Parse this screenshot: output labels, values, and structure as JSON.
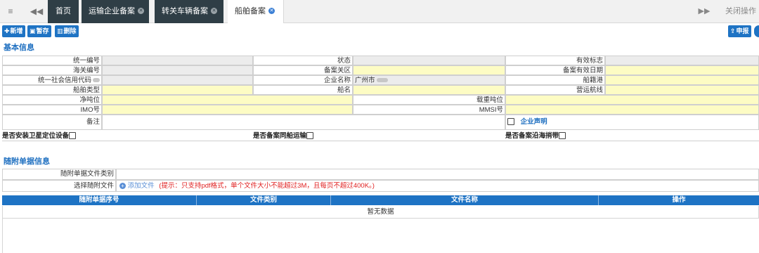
{
  "tabbar": {
    "menu_icon": "hamburger-icon",
    "back_icon": "double-left-arrow-icon",
    "tabs": [
      {
        "label": "首页"
      },
      {
        "label": "运输企业备案"
      },
      {
        "label": "转关车辆备案"
      },
      {
        "label": "船舶备案"
      }
    ],
    "forward_icon": "double-right-arrow-icon",
    "close_ops": "关闭操作"
  },
  "toolbar": {
    "add": "新增",
    "save_draft": "暂存",
    "delete": "删除",
    "declare": "申报"
  },
  "basic": {
    "title": "基本信息",
    "unified_no": "统一编号",
    "status": "状态",
    "valid_flag": "有效标志",
    "customs_no": "海关编号",
    "record_customs": "备案关区",
    "record_valid_date": "备案有效日期",
    "credit_code": "统一社会信用代码",
    "company_name": "企业名称",
    "company_name_value": "广州市",
    "port_of_registry": "船籍港",
    "ship_type": "船舶类型",
    "ship_name": "船名",
    "route": "营运航线",
    "net_tonnage": "净吨位",
    "deadweight": "载重吨位",
    "imo": "IMO号",
    "mmsi": "MMSI号",
    "remark": "备注",
    "company_statement": "企业声明",
    "q_satellite": "是否安装卫星定位设备",
    "q_same_ship": "是否备案同船运输",
    "q_coastal": "是否备案沿海捎带"
  },
  "attach": {
    "title": "随附单据信息",
    "file_category": "随附单据文件类别",
    "select_file": "选择随附文件",
    "add_file": "添加文件",
    "hint": "(提示：只支持pdf格式，单个文件大小不能超过3M，且每页不超过400K。)",
    "columns": [
      "随附单据序号",
      "文件类别",
      "文件名称",
      "操作"
    ],
    "empty": "暂无数据"
  },
  "colors": {
    "primary": "#1e73c4",
    "dark_tab": "#2f3e46",
    "required_field": "#fdfcc4",
    "readonly_field": "#ececec",
    "hint_red": "#e02020"
  }
}
